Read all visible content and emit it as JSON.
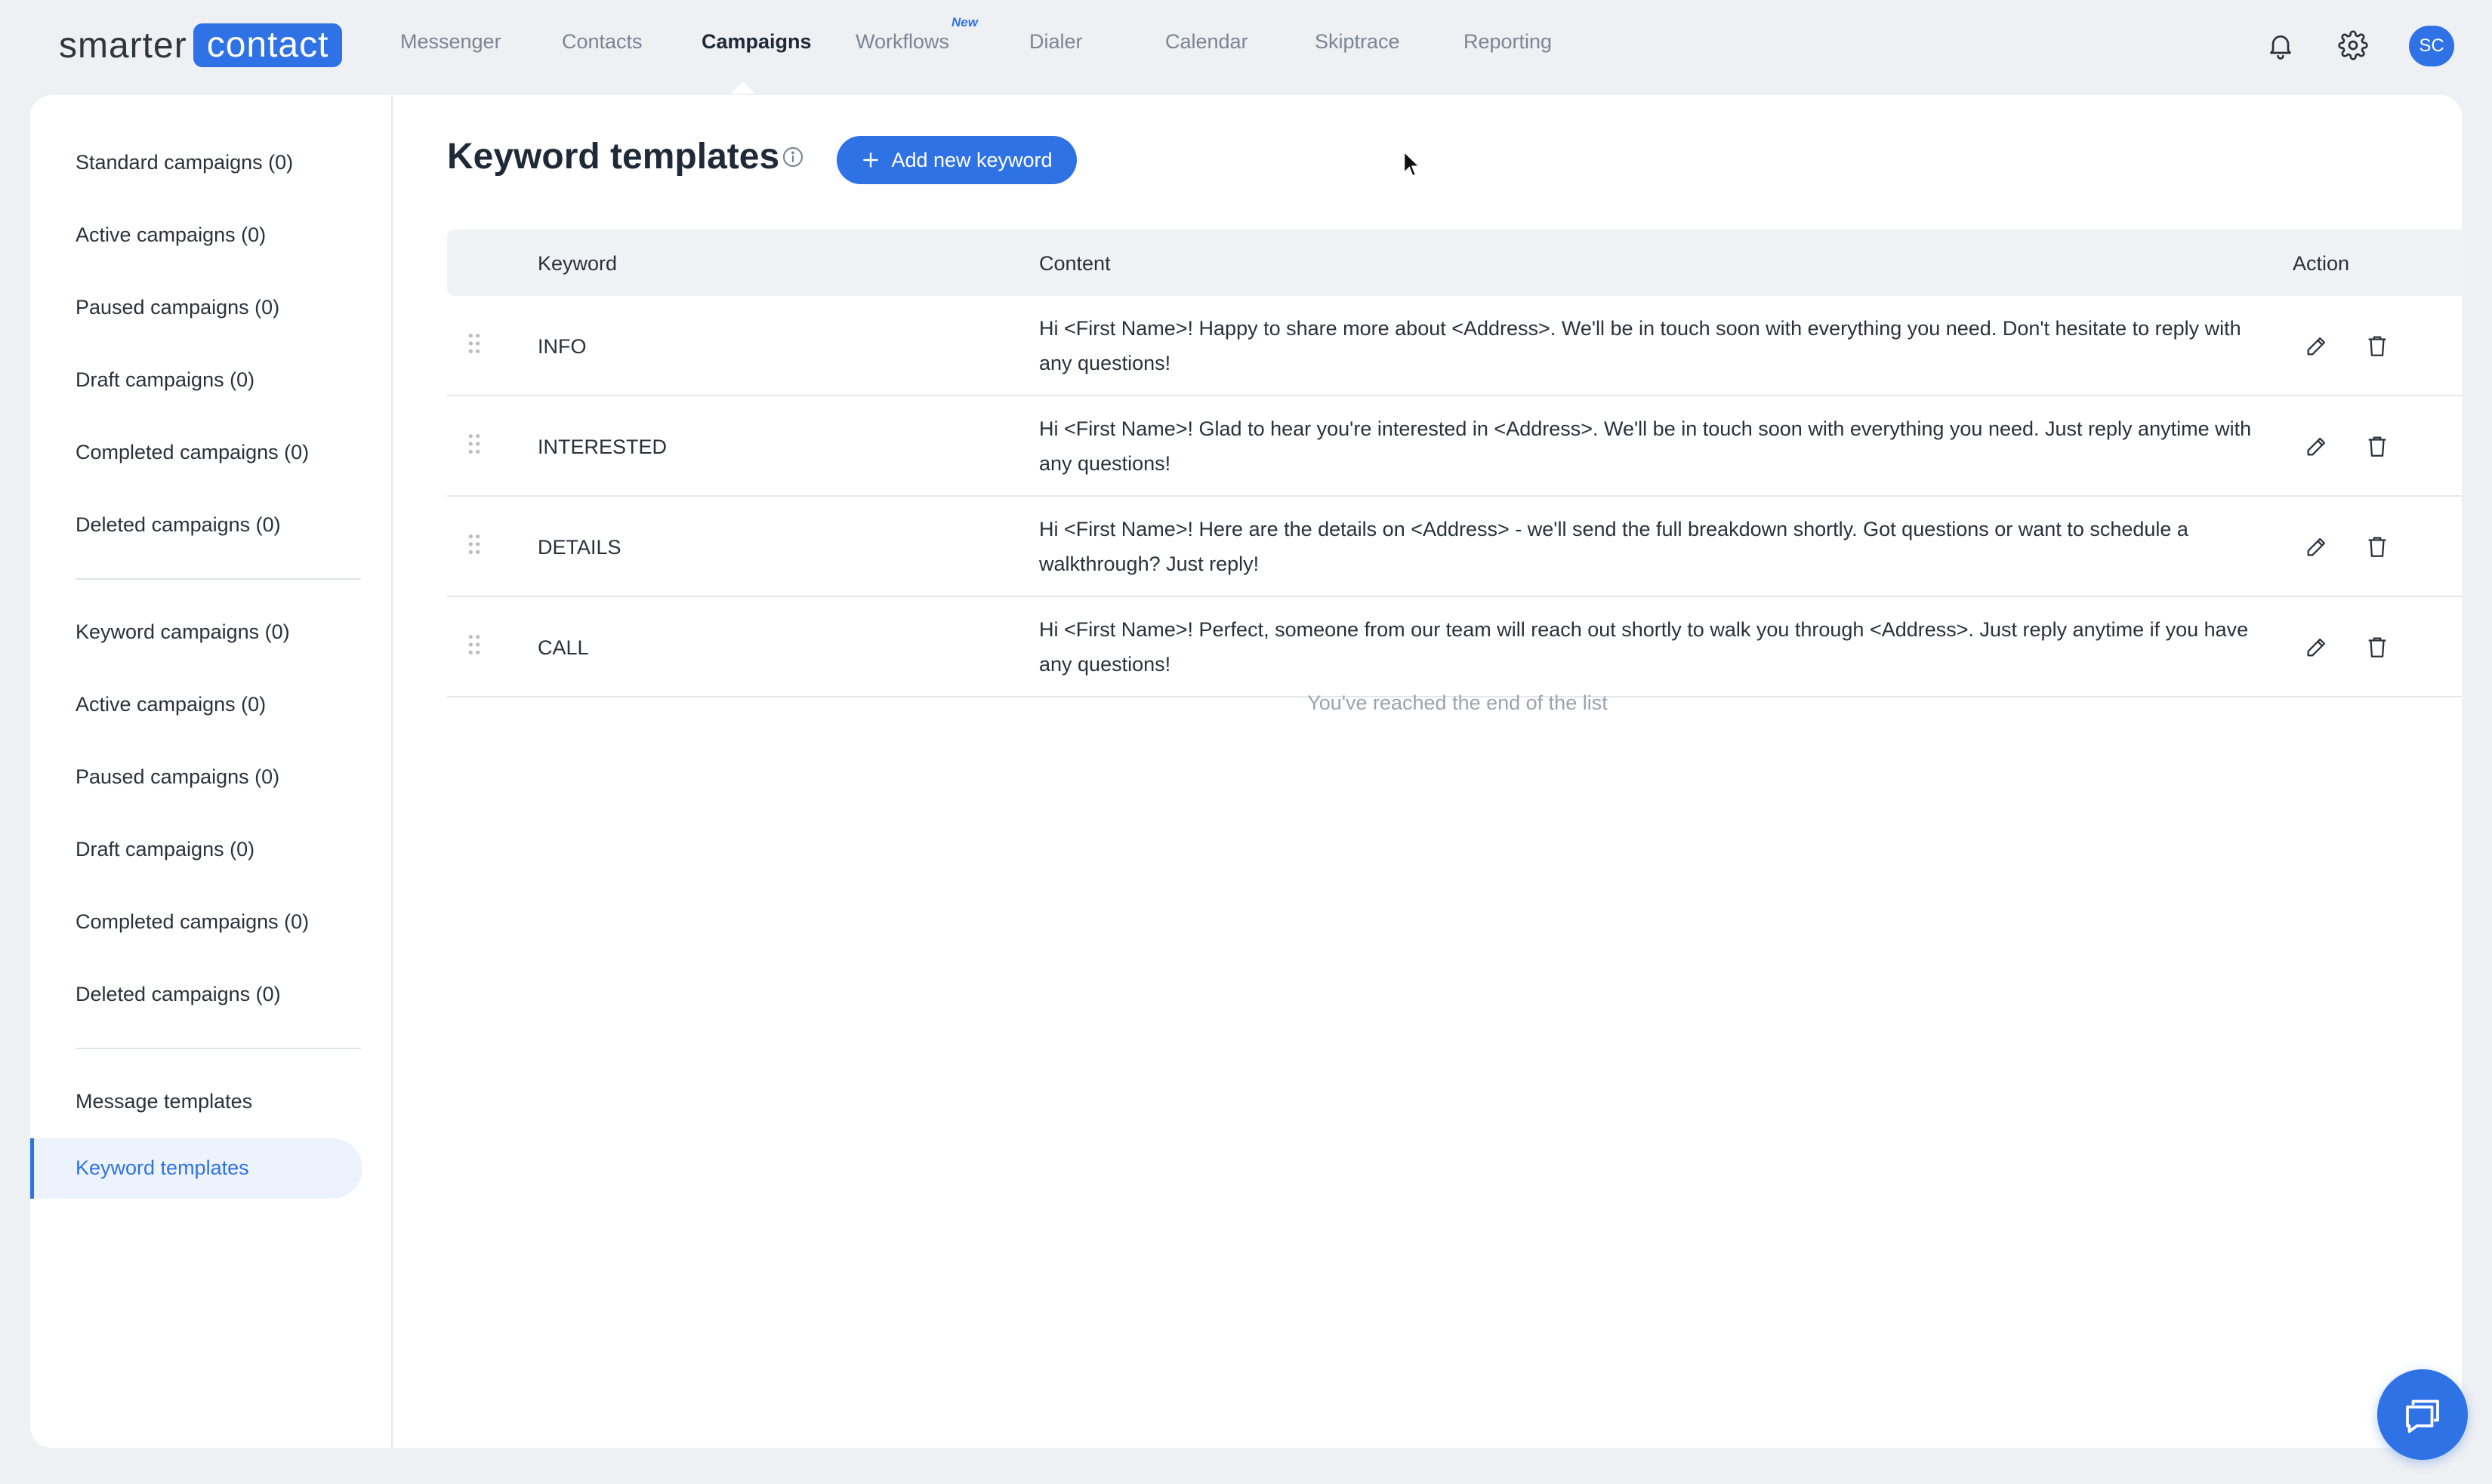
{
  "logo": {
    "left": "smarter",
    "right": "contact"
  },
  "nav": {
    "items": [
      {
        "label": "Messenger"
      },
      {
        "label": "Contacts"
      },
      {
        "label": "Campaigns"
      },
      {
        "label": "Workflows"
      },
      {
        "label": "Dialer"
      },
      {
        "label": "Calendar"
      },
      {
        "label": "Skiptrace"
      },
      {
        "label": "Reporting"
      }
    ],
    "active": "Campaigns",
    "new_badge": "New",
    "avatar_initials": "SC"
  },
  "sidebar": {
    "group1": [
      {
        "label": "Standard campaigns (0)"
      },
      {
        "label": "Active campaigns (0)"
      },
      {
        "label": "Paused campaigns (0)"
      },
      {
        "label": "Draft campaigns (0)"
      },
      {
        "label": "Completed campaigns (0)"
      },
      {
        "label": "Deleted campaigns (0)"
      }
    ],
    "group2": [
      {
        "label": "Keyword campaigns (0)"
      },
      {
        "label": "Active campaigns (0)"
      },
      {
        "label": "Paused campaigns (0)"
      },
      {
        "label": "Draft campaigns (0)"
      },
      {
        "label": "Completed campaigns (0)"
      },
      {
        "label": "Deleted campaigns (0)"
      }
    ],
    "group3": [
      {
        "label": "Message templates"
      },
      {
        "label": "Keyword templates"
      }
    ],
    "active": "Keyword templates"
  },
  "main": {
    "title": "Keyword templates",
    "add_button": "Add new keyword",
    "table": {
      "headers": {
        "keyword": "Keyword",
        "content": "Content",
        "action": "Action"
      },
      "rows": [
        {
          "keyword": "INFO",
          "content": "Hi <First Name>! Happy to share more about <Address>. We'll be in touch soon with everything you need. Don't hesitate to reply with any questions!"
        },
        {
          "keyword": "INTERESTED",
          "content": "Hi <First Name>! Glad to hear you're interested in <Address>. We'll be in touch soon with everything you need. Just reply anytime with any questions!"
        },
        {
          "keyword": "DETAILS",
          "content": "Hi <First Name>! Here are the details on <Address> - we'll send the full breakdown shortly. Got questions or want to schedule a walkthrough? Just reply!"
        },
        {
          "keyword": "CALL",
          "content": "Hi <First Name>! Perfect, someone from our team will reach out shortly to walk you through <Address>. Just reply anytime if you have any questions!"
        }
      ]
    },
    "end_message": "You've reached the end of the list"
  },
  "colors": {
    "accent": "#2f72e6",
    "background": "#eef0f3",
    "card": "#ffffff",
    "sidebar_active_bg": "#edf3fd",
    "muted_text": "#7b8593"
  },
  "icons": {
    "bell": "bell-icon",
    "settings": "gear-icon",
    "info": "info-icon",
    "plus": "plus-icon",
    "edit": "pencil-icon",
    "delete": "trash-icon",
    "drag": "drag-handle-icon",
    "chat": "chat-icon"
  }
}
